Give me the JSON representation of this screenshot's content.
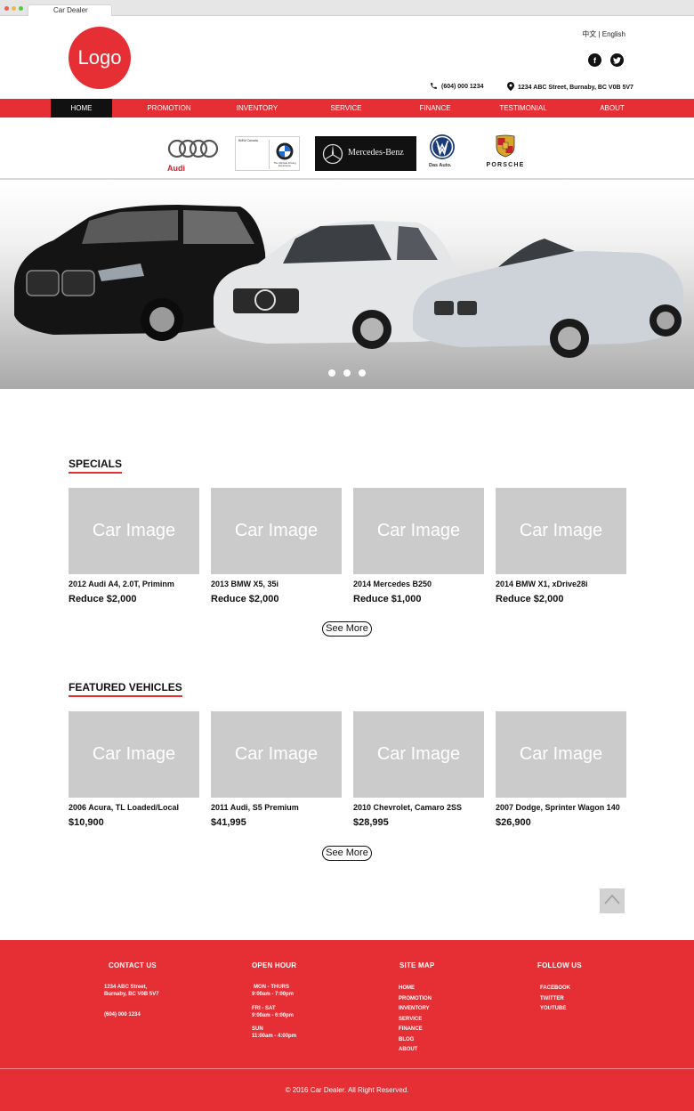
{
  "browser": {
    "tab_title": "Car Dealer"
  },
  "header": {
    "logo_text": "Logo",
    "language": "中文 | English",
    "phone": "(604) 000 1234",
    "address": "1234 ABC Street, Burnaby, BC  V0B 5V7"
  },
  "nav": {
    "items": [
      "HOME",
      "PROMOTION",
      "INVENTORY",
      "SERVICE",
      "FINANCE",
      "TESTIMONIAL",
      "ABOUT"
    ],
    "active": "HOME",
    "accent_color": "#e52f35"
  },
  "brands": {
    "audi": "Audi",
    "bmw_top": "BMW Canada",
    "bmw_bottom": "The Ultimate Driving Experience",
    "mercedes": "Mercedes-Benz",
    "vw": "Das Auto.",
    "porsche": "PORSCHE"
  },
  "hero": {
    "slide_count": 3
  },
  "specials": {
    "title": "SPECIALS",
    "see_more": "See More",
    "cars": [
      {
        "image": "Car Image",
        "name": "2012 Audi A4, 2.0T, Priminm",
        "price": "Reduce $2,000"
      },
      {
        "image": "Car Image",
        "name": "2013 BMW  X5, 35i",
        "price": "Reduce $2,000"
      },
      {
        "image": "Car Image",
        "name": "2014 Mercedes B250",
        "price": "Reduce $1,000"
      },
      {
        "image": "Car Image",
        "name": "2014 BMW X1, xDrive28i",
        "price": "Reduce $2,000"
      }
    ]
  },
  "featured": {
    "title": "FEATURED VEHICLES",
    "see_more": "See More",
    "cars": [
      {
        "image": "Car Image",
        "name": "2006 Acura, TL Loaded/Local",
        "price": "$10,900"
      },
      {
        "image": "Car Image",
        "name": "2011 Audi, S5 Premium",
        "price": "$41,995"
      },
      {
        "image": "Car Image",
        "name": "2010 Chevrolet, Camaro 2SS",
        "price": "$28,995"
      },
      {
        "image": "Car Image",
        "name": "2007 Dodge, Sprinter Wagon 140",
        "price": "$26,900"
      }
    ]
  },
  "footer": {
    "contact": {
      "title": "CONTACT US",
      "address_1": "1234 ABC Street,",
      "address_2": "Burnaby, BC  V0B 5V7",
      "phone": "(604) 000 1234"
    },
    "hours": {
      "title": "OPEN HOUR",
      "blocks": [
        {
          "days": "MON - THURS",
          "time": "9:00am - 7:00pm"
        },
        {
          "days": "FRI - SAT",
          "time": "9:00am - 6:00pm"
        },
        {
          "days": "SUN",
          "time": "11:00am - 4:00pm"
        }
      ]
    },
    "sitemap": {
      "title": "SITE MAP",
      "links": [
        "HOME",
        "PROMOTION",
        "INVENTORY",
        "SERVICE",
        "FINANCE",
        "BLOG",
        "ABOUT"
      ]
    },
    "follow": {
      "title": "FOLLOW US",
      "links": [
        "FACEBOOK",
        "TWITTER",
        "YOUTUBE"
      ]
    },
    "copyright": "© 2016 Car Dealer. All Right Reserved."
  }
}
